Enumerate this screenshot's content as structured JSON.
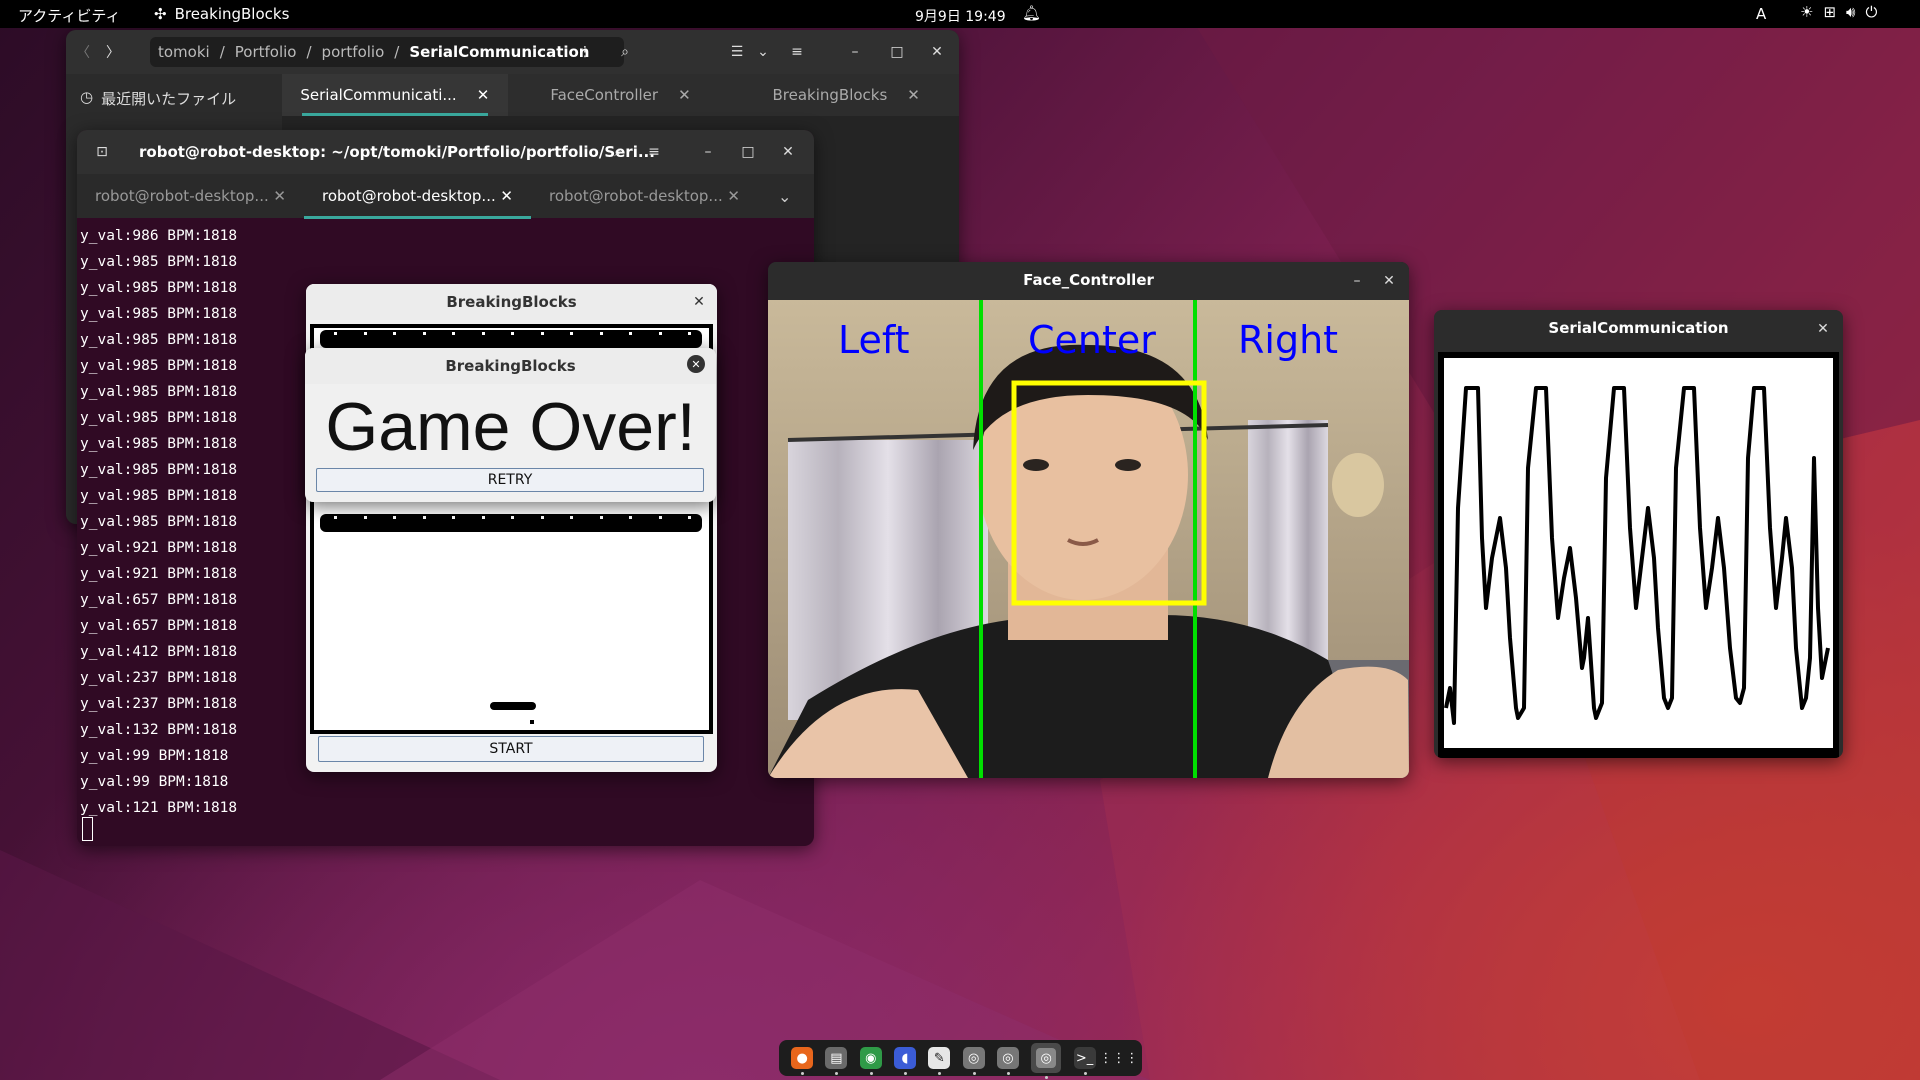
{
  "topbar": {
    "activities": "アクティビティ",
    "app_name": "BreakingBlocks",
    "clock": "9月9日  19:49",
    "ime": "A"
  },
  "files": {
    "path": [
      "tomoki",
      "Portfolio",
      "portfolio",
      "SerialCommunication"
    ],
    "recent": "最近開いたファイル",
    "tabs": [
      "SerialCommunicati...",
      "FaceController",
      "BreakingBlocks"
    ]
  },
  "terminal": {
    "title": "robot@robot-desktop: ~/opt/tomoki/Portfolio/portfolio/Seri...",
    "tabs": [
      "robot@robot-desktop...",
      "robot@robot-desktop...",
      "robot@robot-desktop..."
    ],
    "lines": [
      "y_val:986 BPM:1818",
      "y_val:985 BPM:1818",
      "y_val:985 BPM:1818",
      "y_val:985 BPM:1818",
      "y_val:985 BPM:1818",
      "y_val:985 BPM:1818",
      "y_val:985 BPM:1818",
      "y_val:985 BPM:1818",
      "y_val:985 BPM:1818",
      "y_val:985 BPM:1818",
      "y_val:985 BPM:1818",
      "y_val:985 BPM:1818",
      "y_val:921 BPM:1818",
      "y_val:921 BPM:1818",
      "y_val:657 BPM:1818",
      "y_val:657 BPM:1818",
      "y_val:412 BPM:1818",
      "y_val:237 BPM:1818",
      "y_val:237 BPM:1818",
      "y_val:132 BPM:1818",
      "y_val:99 BPM:1818",
      "y_val:99 BPM:1818",
      "y_val:121 BPM:1818"
    ]
  },
  "breaking_blocks": {
    "title": "BreakingBlocks",
    "start": "START"
  },
  "game_over": {
    "title": "BreakingBlocks",
    "message": "Game Over!",
    "retry": "RETRY"
  },
  "face": {
    "title": "Face_Controller",
    "left": "Left",
    "center": "Center",
    "right": "Right"
  },
  "serial": {
    "title": "SerialCommunication"
  },
  "dock": [
    "firefox",
    "files",
    "chrome",
    "discord",
    "text-editor",
    "app-1",
    "app-2",
    "app-3",
    "terminal",
    "app-grid"
  ]
}
